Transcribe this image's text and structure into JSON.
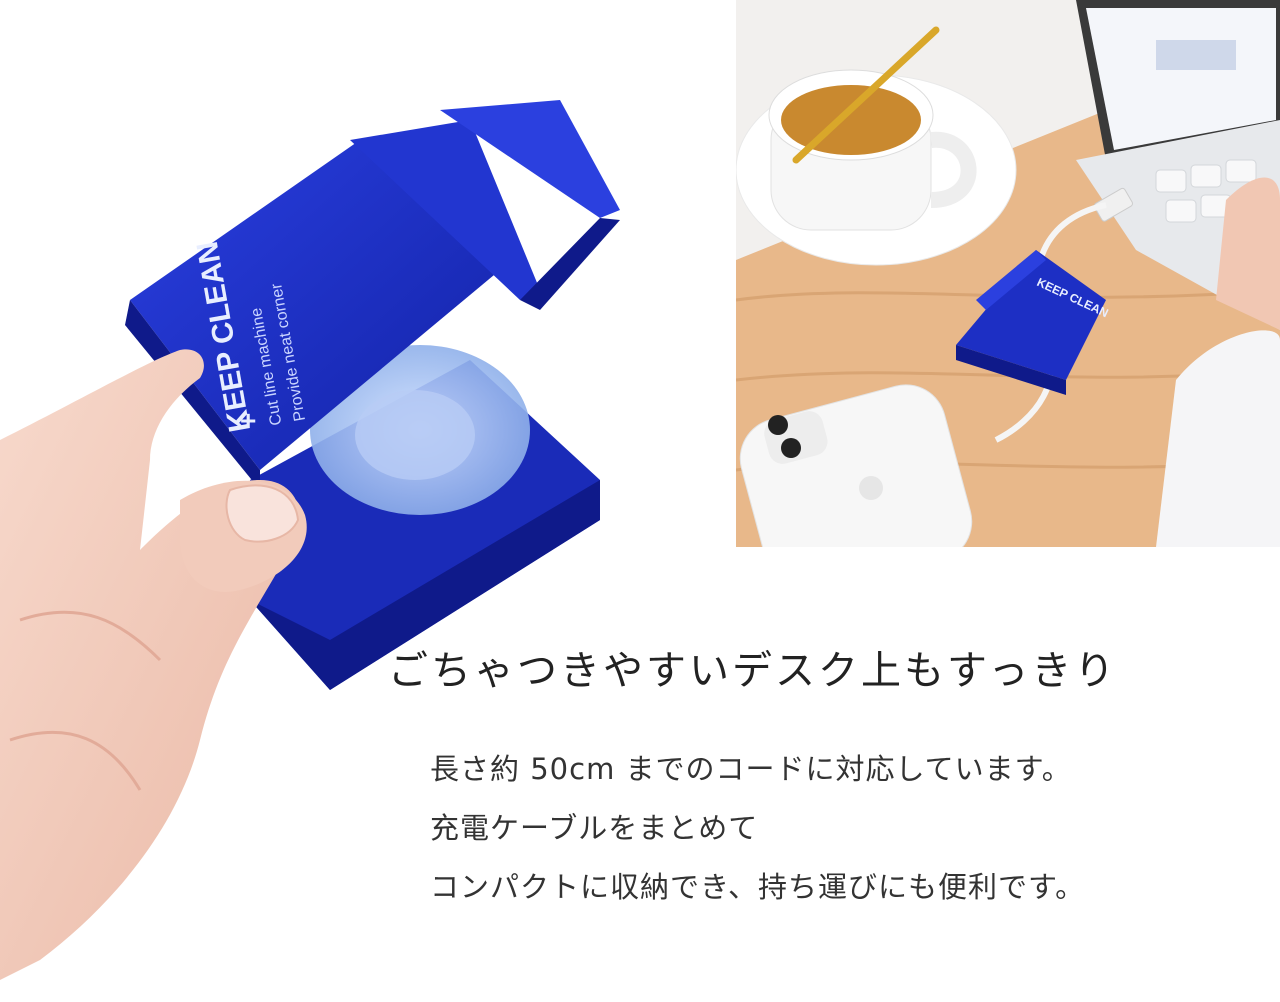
{
  "product": {
    "brand_text": "KEEP CLEAN",
    "line1": "Cut line machine",
    "line2": "Provide neat corner",
    "plus_mark": "+",
    "small_brand": "KEEP CLEAN"
  },
  "headline": "ごちゃつきやすいデスク上もすっきり",
  "body_lines": [
    "長さ約 50cm までのコードに対応しています。",
    "充電ケーブルをまとめて",
    "コンパクトに収納でき、持ち運びにも便利です。"
  ],
  "colors": {
    "device_blue": "#1d2fc4",
    "device_blue_dark": "#0f1a8a",
    "table_wood": "#e6b98a",
    "skin": "#f3cfc0"
  }
}
